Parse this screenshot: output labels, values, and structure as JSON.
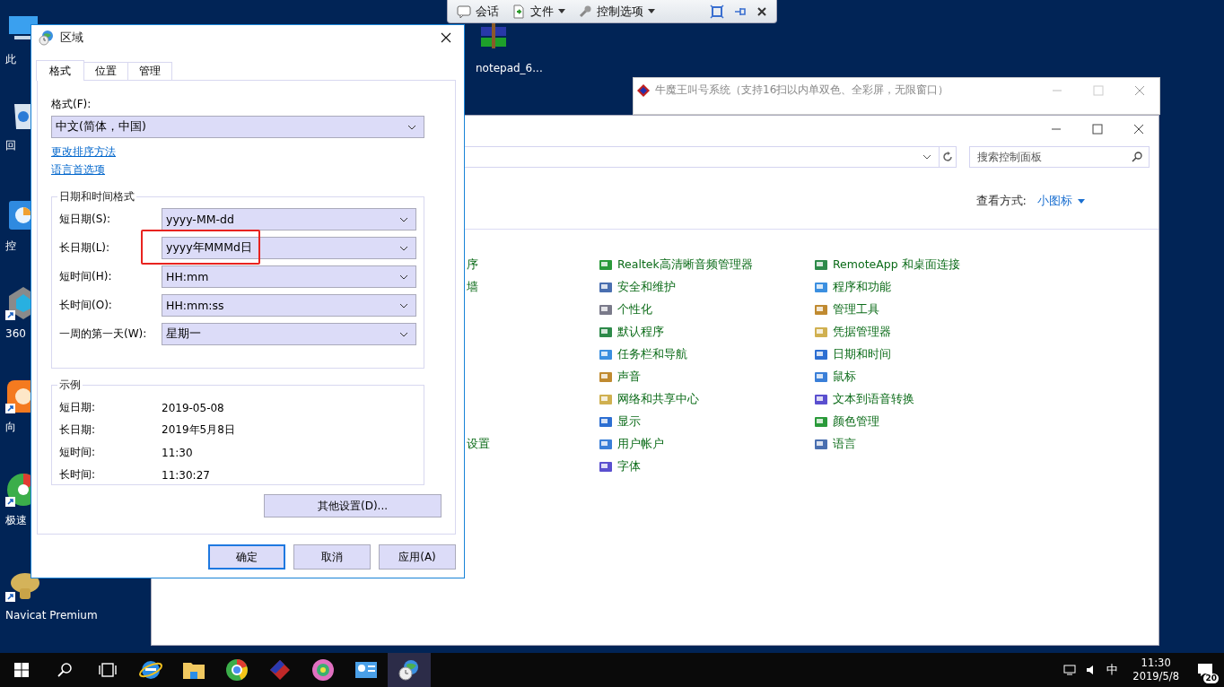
{
  "remote_toolbar": {
    "items": [
      {
        "label": "会话",
        "dropdown": false
      },
      {
        "label": "文件",
        "dropdown": true
      },
      {
        "label": "控制选项",
        "dropdown": true
      }
    ]
  },
  "desktop_icons": [
    {
      "label": "此",
      "kind": "monitor",
      "shortcut": false
    },
    {
      "label": "回",
      "kind": "recycle",
      "shortcut": false
    },
    {
      "label": "控",
      "kind": "panel",
      "shortcut": false
    },
    {
      "label": "360",
      "kind": "shield",
      "shortcut": true
    },
    {
      "label": "向",
      "kind": "sun",
      "shortcut": true
    },
    {
      "label": "极速",
      "kind": "browser",
      "shortcut": true
    },
    {
      "label": "Navicat Premium",
      "kind": "navicat",
      "shortcut": true
    },
    {
      "label": "notepad_6...",
      "kind": "archive",
      "shortcut": false
    }
  ],
  "background_window": {
    "title": "牛魔王叫号系统（支持16扫以内单双色、全彩屏，无限窗口）"
  },
  "control_panel": {
    "search": {
      "placeholder": "搜索控制面板"
    },
    "view_label": "查看方式:",
    "view_value": "小图标",
    "columns": [
      [
        "序",
        "墙",
        "设置"
      ],
      [
        "Realtek高清晰音频管理器",
        "安全和维护",
        "个性化",
        "默认程序",
        "任务栏和导航",
        "声音",
        "网络和共享中心",
        "显示",
        "用户帐户",
        "字体"
      ],
      [
        "RemoteApp 和桌面连接",
        "程序和功能",
        "管理工具",
        "凭据管理器",
        "日期和时间",
        "鼠标",
        "文本到语音转换",
        "颜色管理",
        "语言"
      ]
    ]
  },
  "region_dialog": {
    "title": "区域",
    "tabs": [
      {
        "label": "格式",
        "selected": true
      },
      {
        "label": "位置",
        "selected": false
      },
      {
        "label": "管理",
        "selected": false
      }
    ],
    "format_label": "格式(F):",
    "format_value": "中文(简体，中国)",
    "links": [
      "更改排序方法",
      "语言首选项"
    ],
    "formats_group": {
      "title": "日期和时间格式",
      "rows": [
        {
          "label": "短日期(S):",
          "value": "yyyy-MM-dd",
          "highlighted": false
        },
        {
          "label": "长日期(L):",
          "value": "yyyy年MMMd日",
          "highlighted": true
        },
        {
          "label": "短时间(H):",
          "value": "HH:mm",
          "highlighted": false
        },
        {
          "label": "长时间(O):",
          "value": "HH:mm:ss",
          "highlighted": false
        },
        {
          "label": "一周的第一天(W):",
          "value": "星期一",
          "highlighted": false
        }
      ]
    },
    "examples_group": {
      "title": "示例",
      "rows": [
        {
          "label": "短日期:",
          "value": "2019-05-08"
        },
        {
          "label": "长日期:",
          "value": "2019年5月8日"
        },
        {
          "label": "短时间:",
          "value": "11:30"
        },
        {
          "label": "长时间:",
          "value": "11:30:27"
        }
      ]
    },
    "more_button": "其他设置(D)...",
    "buttons": [
      {
        "label": "确定",
        "default": true
      },
      {
        "label": "取消",
        "default": false
      },
      {
        "label": "应用(A)",
        "default": false
      }
    ]
  },
  "taskbar": {
    "apps": [
      {
        "kind": "ie",
        "active": false
      },
      {
        "kind": "folder",
        "active": false
      },
      {
        "kind": "chrome",
        "active": false
      },
      {
        "kind": "cube",
        "active": false
      },
      {
        "kind": "flower",
        "active": false
      },
      {
        "kind": "panel",
        "active": false
      },
      {
        "kind": "globe",
        "active": true
      }
    ],
    "ime": "中",
    "time": "11:30",
    "date": "2019/5/8",
    "notifications": "20"
  }
}
